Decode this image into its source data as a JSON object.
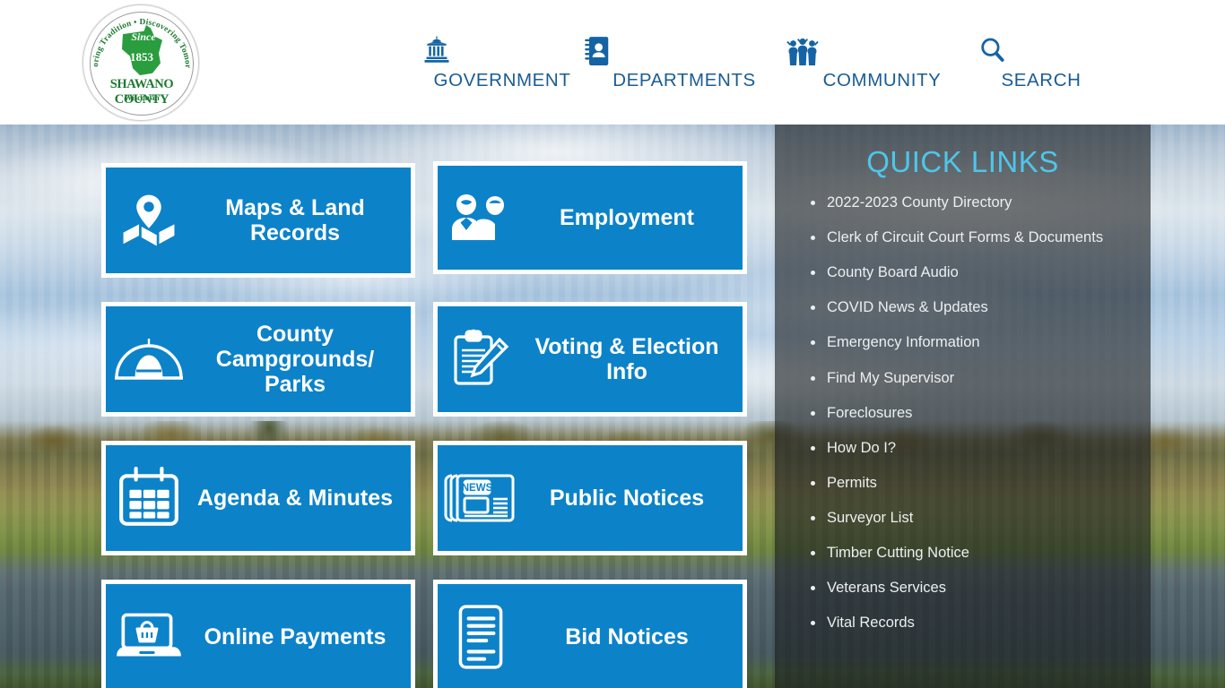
{
  "header": {
    "logo": {
      "motto": "Honoring Tradition • Discovering Tomorrow",
      "since": "Since",
      "year": "1853",
      "name": "SHAWANO COUNTY",
      "state": "Wisconsin"
    },
    "nav": [
      {
        "label": "GOVERNMENT",
        "icon": "courthouse-icon"
      },
      {
        "label": "DEPARTMENTS",
        "icon": "address-book-icon"
      },
      {
        "label": "COMMUNITY",
        "icon": "people-group-icon"
      },
      {
        "label": "SEARCH",
        "icon": "magnifier-icon"
      }
    ]
  },
  "tiles": [
    {
      "label": "Maps & Land Records",
      "icon": "map-pin-icon"
    },
    {
      "label": "Employment",
      "icon": "two-people-icon"
    },
    {
      "label": "County Campgrounds/ Parks",
      "icon": "tent-icon"
    },
    {
      "label": "Voting & Election Info",
      "icon": "clipboard-pencil-icon"
    },
    {
      "label": "Agenda & Minutes",
      "icon": "calendar-icon"
    },
    {
      "label": "Public Notices",
      "icon": "newspaper-icon"
    },
    {
      "label": "Online Payments",
      "icon": "laptop-basket-icon"
    },
    {
      "label": "Bid Notices",
      "icon": "document-lines-icon"
    }
  ],
  "quick_links": {
    "title": "QUICK LINKS",
    "items": [
      "2022-2023 County Directory",
      "Clerk of Circuit Court Forms & Documents",
      "County Board Audio",
      "COVID News & Updates",
      "Emergency Information",
      "Find My Supervisor",
      "Foreclosures",
      "How Do I?",
      "Permits",
      "Surveyor List",
      "Timber Cutting Notice",
      "Veterans Services",
      "Vital Records"
    ]
  },
  "colors": {
    "tile_blue": "#0c82c9",
    "nav_blue": "#1a5c96",
    "quicklinks_heading": "#4ec6ea",
    "seal_green": "#1d7a32"
  },
  "news_badge": "NEWS"
}
